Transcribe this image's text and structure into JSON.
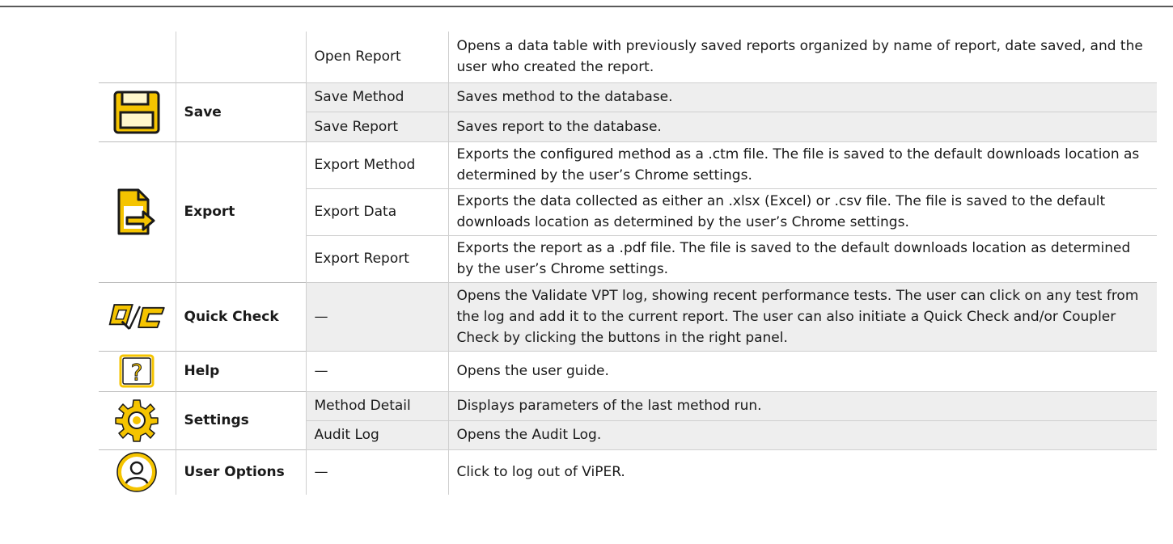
{
  "rows": [
    {
      "name": "",
      "function": "Open Report",
      "description": "Opens a data table with previously saved reports organized by name of report, date saved, and the user who created the report."
    },
    {
      "name": "Save",
      "icon": "floppy-disk-icon",
      "function": "Save Method",
      "description": "Saves method to the database."
    },
    {
      "name": "",
      "function": "Save Report",
      "description": "Saves report to the database."
    },
    {
      "name": "Export",
      "icon": "export-file-icon",
      "function": "Export Method",
      "description": "Exports the configured method as a .ctm file. The file is saved to the default downloads location as determined by the user’s Chrome settings."
    },
    {
      "name": "",
      "function": "Export Data",
      "description": "Exports the data collected as either an .xlsx (Excel) or .csv file. The file is saved to the default downloads location as determined by the user’s Chrome settings."
    },
    {
      "name": "",
      "function": "Export Report",
      "description": "Exports the report as a .pdf file. The file is saved to the default downloads location as determined by the user’s Chrome settings."
    },
    {
      "name": "Quick Check",
      "icon": "quick-check-icon",
      "function": "—",
      "description": "Opens the Validate VPT log, showing recent performance tests. The user can click on any test from the log and add it to the current report. The user can also initiate a Quick Check and/or Coupler Check by clicking the buttons in the right panel."
    },
    {
      "name": "Help",
      "icon": "help-question-icon",
      "function": "—",
      "description": "Opens the user guide."
    },
    {
      "name": "Settings",
      "icon": "gear-icon",
      "function": "Method Detail",
      "description": "Displays parameters of the last method run."
    },
    {
      "name": "",
      "function": "Audit Log",
      "description": "Opens the Audit Log."
    },
    {
      "name": "User Options",
      "icon": "user-avatar-icon",
      "function": "—",
      "description": "Click to log out of ViPER."
    }
  ],
  "colors": {
    "icon_yellow": "#f5c400",
    "icon_dark": "#1a1a1a",
    "row_shade": "#eeeeee",
    "rule": "#cfcfcf"
  }
}
